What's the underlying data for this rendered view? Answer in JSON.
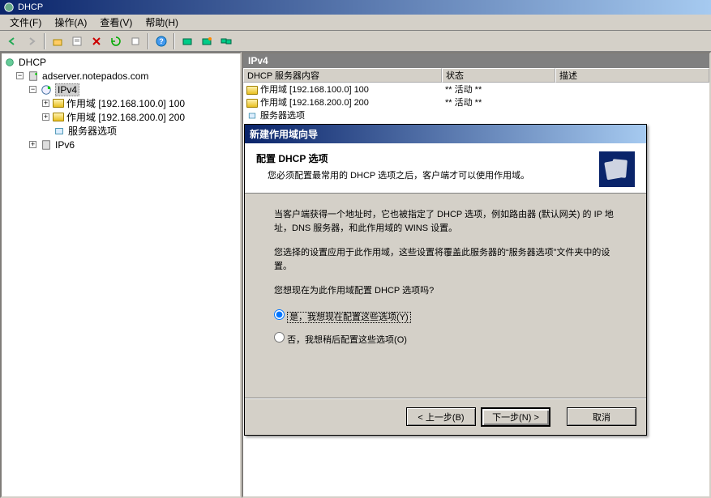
{
  "window": {
    "title": "DHCP"
  },
  "menubar": {
    "file": "文件(F)",
    "action": "操作(A)",
    "view": "查看(V)",
    "help": "帮助(H)"
  },
  "tree": {
    "root": "DHCP",
    "server": "adserver.notepados.com",
    "ipv4": "IPv4",
    "scope1": "作用域 [192.168.100.0] 100",
    "scope2": "作用域 [192.168.200.0] 200",
    "serveropts": "服务器选项",
    "ipv6": "IPv6"
  },
  "rightpanel": {
    "title": "IPv4",
    "columns": {
      "content": "DHCP 服务器内容",
      "status": "状态",
      "desc": "描述"
    },
    "rows": [
      {
        "name": "作用域 [192.168.100.0] 100",
        "status": "** 活动 **"
      },
      {
        "name": "作用域 [192.168.200.0] 200",
        "status": "** 活动 **"
      },
      {
        "name": "服务器选项",
        "status": ""
      }
    ]
  },
  "dialog": {
    "title": "新建作用域向导",
    "header_title": "配置 DHCP 选项",
    "header_sub": "您必须配置最常用的 DHCP 选项之后，客户端才可以使用作用域。",
    "body1": "当客户端获得一个地址时，它也被指定了 DHCP 选项，例如路由器 (默认网关) 的 IP 地址，DNS 服务器，和此作用域的 WINS 设置。",
    "body2": "您选择的设置应用于此作用域，这些设置将覆盖此服务器的“服务器选项”文件夹中的设置。",
    "body3": "您想现在为此作用域配置 DHCP 选项吗?",
    "radio_yes": "是，我想现在配置这些选项(Y)",
    "radio_no": "否，我想稍后配置这些选项(O)",
    "btn_back": "< 上一步(B)",
    "btn_next": "下一步(N) >",
    "btn_cancel": "取消"
  }
}
